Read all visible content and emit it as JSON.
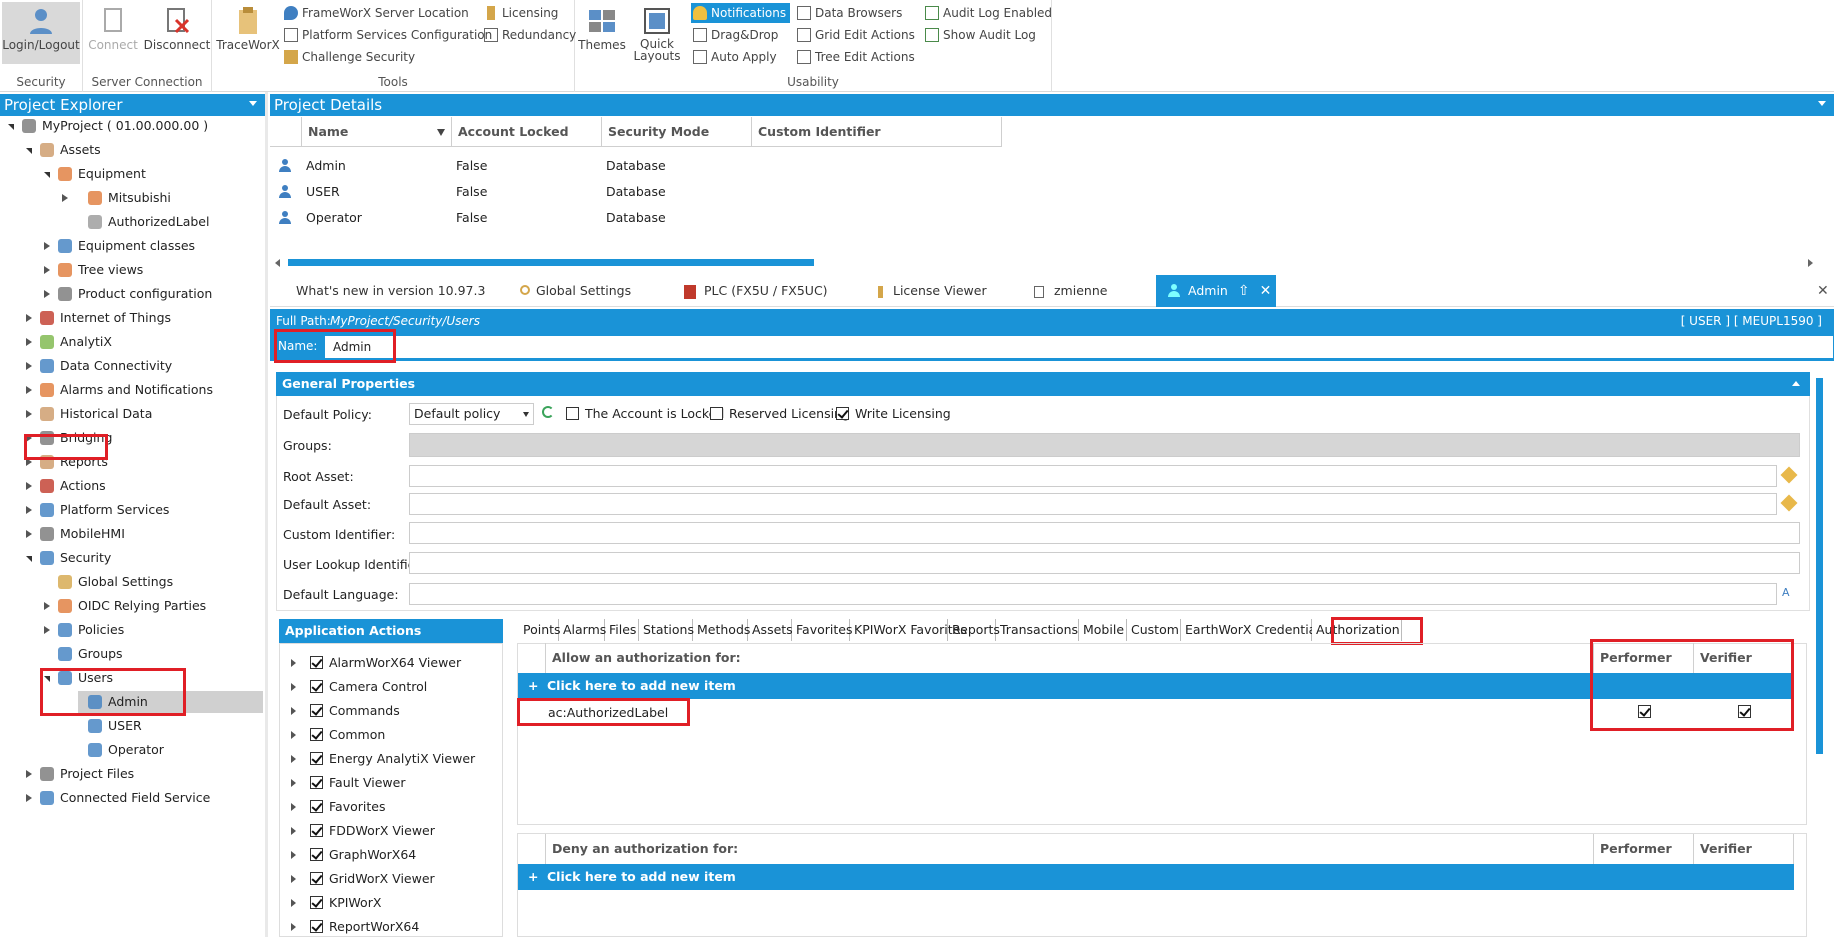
{
  "ribbon": {
    "security": {
      "group": "Security",
      "login": "Login/Logout"
    },
    "server": {
      "group": "Server Connection",
      "connect": "Connect",
      "disconnect": "Disconnect"
    },
    "tools": {
      "group": "Tools",
      "traceworx": "TraceWorX",
      "server_location": "FrameWorX Server Location",
      "platform_config": "Platform Services Configuration",
      "challenge": "Challenge Security",
      "licensing": "Licensing",
      "redundancy": "Redundancy"
    },
    "usability": {
      "group": "Usability",
      "themes": "Themes",
      "quick_layouts": "Quick Layouts",
      "notifications": "Notifications",
      "dragdrop": "Drag&Drop",
      "auto_apply": "Auto Apply",
      "data_browsers": "Data Browsers",
      "grid_edit": "Grid Edit Actions",
      "tree_edit": "Tree Edit Actions",
      "audit_enabled": "Audit Log Enabled",
      "show_audit": "Show Audit Log"
    }
  },
  "explorer": {
    "title": "Project Explorer",
    "nodes": [
      "MyProject ( 01.00.000.00 )",
      "Assets",
      "Equipment",
      "Mitsubishi",
      "AuthorizedLabel",
      "Equipment classes",
      "Tree views",
      "Product configuration",
      "Internet of Things",
      "AnalytiX",
      "Data Connectivity",
      "Alarms and Notifications",
      "Historical Data",
      "Bridging",
      "Reports",
      "Actions",
      "Platform Services",
      "MobileHMI",
      "Security",
      "Global Settings",
      "OIDC Relying Parties",
      "Policies",
      "Groups",
      "Users",
      "Admin",
      "USER",
      "Operator",
      "Project Files",
      "Connected Field Service"
    ]
  },
  "details": {
    "title": "Project Details",
    "columns": [
      "Name",
      "Account Locked",
      "Security Mode",
      "Custom Identifier"
    ],
    "rows": [
      [
        "Admin",
        "False",
        "Database",
        ""
      ],
      [
        "USER",
        "False",
        "Database",
        ""
      ],
      [
        "Operator",
        "False",
        "Database",
        ""
      ]
    ]
  },
  "doc_tabs": [
    "What's new in version 10.97.3",
    "Global Settings",
    "PLC (FX5U / FX5UC)",
    "License Viewer",
    "zmienne",
    "Admin"
  ],
  "editor": {
    "full_path_label": "Full Path:",
    "full_path": "MyProject/Security/Users",
    "user_tag": "[ USER ] [ MEUPL1590 ]",
    "name_label": "Name:",
    "name_value": "Admin",
    "general": "General Properties",
    "default_policy_label": "Default Policy:",
    "default_policy_value": "Default policy",
    "locked_label": "The Account is Locked",
    "reserved_label": "Reserved Licensing",
    "write_label": "Write Licensing",
    "groups_label": "Groups:",
    "root_asset_label": "Root Asset:",
    "default_asset_label": "Default Asset:",
    "custom_id_label": "Custom Identifier:",
    "lookup_label": "User Lookup Identifier:",
    "language_label": "Default Language:"
  },
  "app_actions": {
    "title": "Application Actions",
    "items": [
      "AlarmWorX64 Viewer",
      "Camera Control",
      "Commands",
      "Common",
      "Energy AnalytiX Viewer",
      "Fault Viewer",
      "Favorites",
      "FDDWorX Viewer",
      "GraphWorX64",
      "GridWorX Viewer",
      "KPIWorX",
      "ReportWorX64"
    ]
  },
  "subtabs": [
    "Points",
    "Alarms",
    "Files",
    "Stations",
    "Methods",
    "Assets",
    "Favorites",
    "KPIWorX Favorites",
    "Reports",
    "Transactions",
    "Mobile",
    "Custom",
    "EarthWorX Credentials",
    "Authorization"
  ],
  "authorization": {
    "allow_header": "Allow an authorization for:",
    "deny_header": "Deny an authorization for:",
    "performer": "Performer",
    "verifier": "Verifier",
    "add_new": "Click here to add new item",
    "allow_item": "ac:AuthorizedLabel"
  },
  "colors": {
    "accent": "#1a93d7",
    "highlight": "#e01f26"
  }
}
